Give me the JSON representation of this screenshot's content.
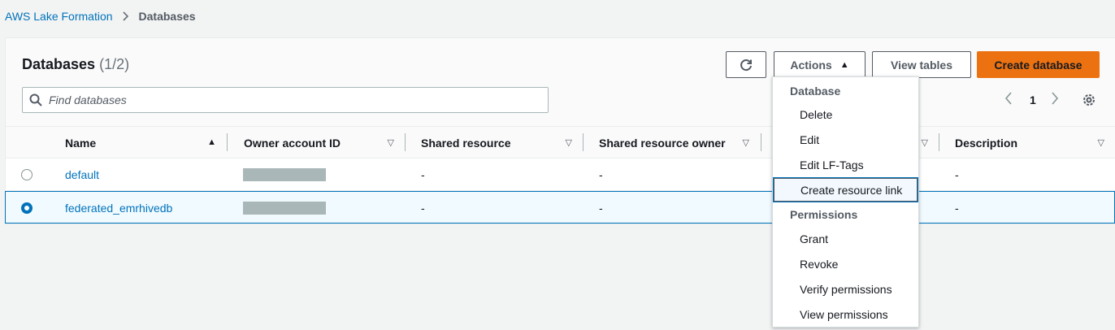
{
  "breadcrumb": {
    "root": "AWS Lake Formation",
    "current": "Databases"
  },
  "panel": {
    "title": "Databases",
    "count": "(1/2)",
    "refresh_icon": "refresh-icon",
    "actions_label": "Actions",
    "view_tables_label": "View tables",
    "create_label": "Create database",
    "search_placeholder": "Find databases",
    "page": "1"
  },
  "table": {
    "columns": [
      "Name",
      "Owner account ID",
      "Shared resource",
      "Shared resource owner",
      "",
      "Description"
    ],
    "rows": [
      {
        "name": "default",
        "owner": "",
        "shared": "-",
        "shared_owner": "-",
        "description": "-",
        "selected": false
      },
      {
        "name": "federated_emrhivedb",
        "owner": "",
        "shared": "-",
        "shared_owner": "-",
        "description": "-",
        "selected": true
      }
    ]
  },
  "dropdown": {
    "database_header": "Database",
    "items_database": [
      "Delete",
      "Edit",
      "Edit LF-Tags",
      "Create resource link"
    ],
    "permissions_header": "Permissions",
    "items_permissions": [
      "Grant",
      "Revoke",
      "Verify permissions",
      "View permissions"
    ]
  },
  "colors": {
    "primary": "#ec7211",
    "link": "#0073bb"
  }
}
